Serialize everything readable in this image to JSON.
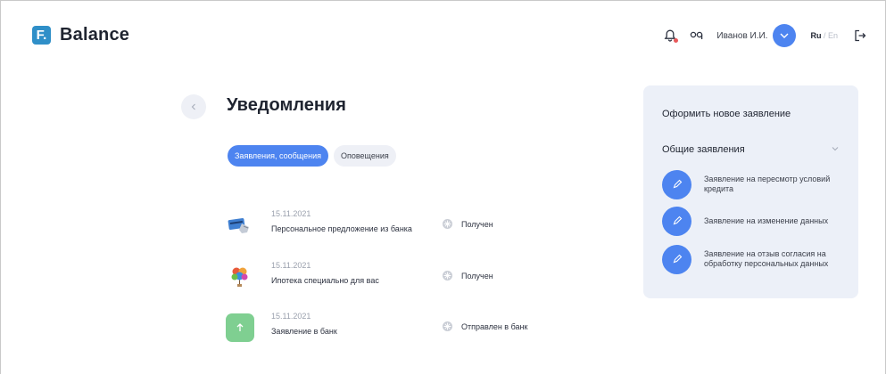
{
  "header": {
    "logo_letter": "F.",
    "logo_text": "Balance",
    "user_name": "Иванов И.И.",
    "lang_active": "Ru",
    "lang_sep": " / ",
    "lang_other": "En"
  },
  "page": {
    "title": "Уведомления",
    "tabs": [
      {
        "label": "Заявления, сообщения",
        "active": true
      },
      {
        "label": "Оповещения",
        "active": false
      }
    ],
    "notifications": [
      {
        "date": "15.11.2021",
        "title": "Персональное предложение из банка",
        "status": "Получен",
        "icon": "credit-card-icon"
      },
      {
        "date": "15.11.2021",
        "title": "Ипотека специально для вас",
        "status": "Получен",
        "icon": "balloons-icon"
      },
      {
        "date": "15.11.2021",
        "title": "Заявление в банк",
        "status": "Отправлен в банк",
        "icon": "arrow-up-icon"
      }
    ]
  },
  "panel": {
    "title": "Оформить новое заявление",
    "section": "Общие заявления",
    "requests": [
      {
        "label": "Заявление на пересмотр условий кредита"
      },
      {
        "label": "Заявление на изменение данных"
      },
      {
        "label": "Заявление на отзыв согласия на обработку персональных данных"
      }
    ]
  },
  "colors": {
    "accent": "#4d84f0",
    "panel_bg": "#ecf0f8",
    "logo": "#2f8fc8",
    "sent_green": "#7fcf91"
  }
}
